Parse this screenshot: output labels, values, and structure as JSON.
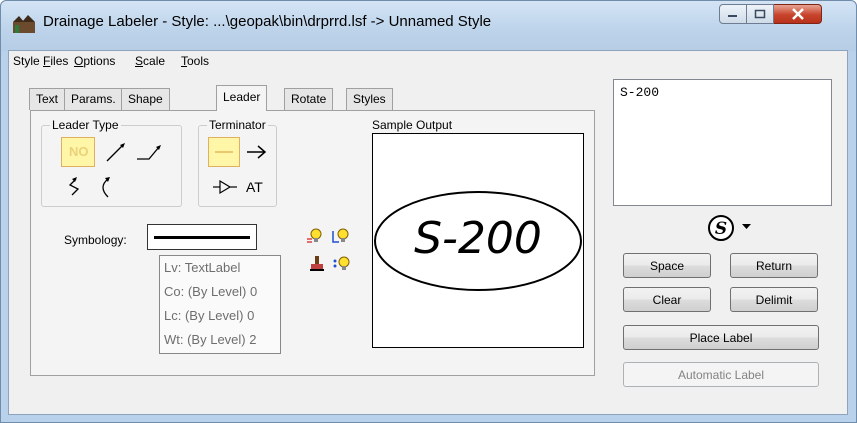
{
  "window": {
    "title": "Drainage Labeler - Style: ...\\geopak\\bin\\drprrd.lsf -> Unnamed Style"
  },
  "menu": {
    "items": [
      {
        "prefix": "Style ",
        "accel": "F",
        "rest": "iles"
      },
      {
        "prefix": "",
        "accel": "O",
        "rest": "ptions"
      },
      {
        "prefix": "",
        "accel": "S",
        "rest": "cale"
      },
      {
        "prefix": "",
        "accel": "T",
        "rest": "ools"
      }
    ]
  },
  "tabs": [
    "Text",
    "Params.",
    "Shape",
    "Leader",
    "Rotate",
    "Styles"
  ],
  "active_tab": "Leader",
  "leader_type": {
    "label": "Leader Type",
    "selected_label": "NO"
  },
  "terminator": {
    "label": "Terminator",
    "at_label": "AT"
  },
  "sample_output": {
    "label": "Sample Output",
    "text": "S-200"
  },
  "symbology": {
    "label": "Symbology:",
    "tooltip": {
      "lv": "Lv: TextLabel",
      "co": "Co: (By Level) 0",
      "lc": "Lc: (By Level) 0",
      "wt": "Wt: (By Level) 2"
    }
  },
  "label_text": "S-200",
  "buttons": {
    "space": "Space",
    "return": "Return",
    "clear": "Clear",
    "delimit": "Delimit",
    "place_label": "Place Label",
    "automatic_label": "Automatic Label"
  },
  "colors": {
    "selected_highlight": "#fff6a8",
    "selected_border": "#e0b060"
  }
}
